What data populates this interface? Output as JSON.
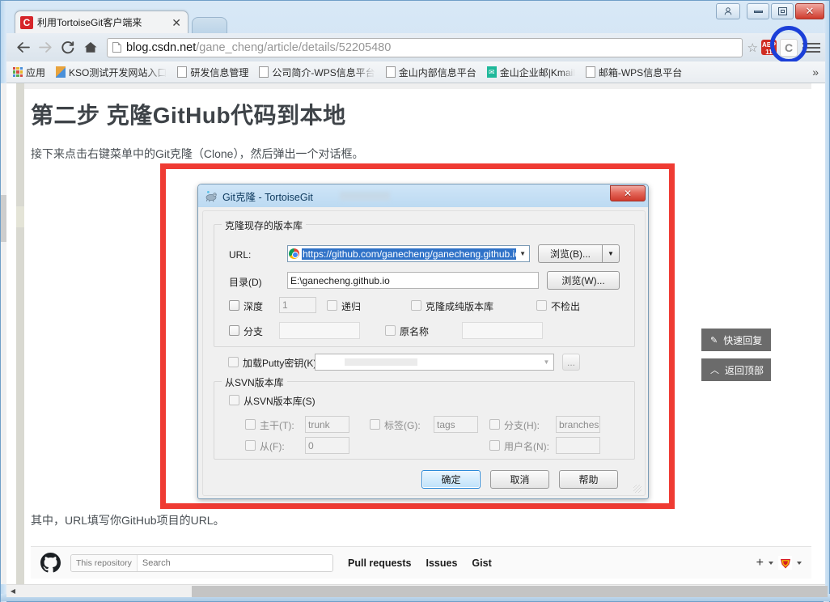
{
  "window": {
    "buttons": {
      "user": "user-account",
      "minimize": "Minimize",
      "maximize": "Maximize",
      "close": "✕"
    }
  },
  "browser": {
    "tab": {
      "title": "利用TortoiseGit客户端来",
      "close": "✕",
      "favicon_letter": "C"
    },
    "nav": {
      "back": "←",
      "forward": "→",
      "reload": "C",
      "home": "⌂"
    },
    "omnibox": {
      "url_host": "blog.csdn.net",
      "url_path": "/gane_cheng/article/details/52205480",
      "star": "☆"
    },
    "extensions": {
      "adblock_label": "ABP",
      "adblock_count": "11",
      "csdn_label": "C"
    },
    "menu": "chrome-menu",
    "bookmarks": [
      {
        "label": "应用",
        "icon": "apps-grid-icon"
      },
      {
        "label": "KSO测试开发网站入口",
        "icon": "wps-icon",
        "fade": true
      },
      {
        "label": "研发信息管理",
        "icon": "doc-icon"
      },
      {
        "label": "公司简介-WPS信息平台",
        "icon": "doc-icon",
        "fade": true
      },
      {
        "label": "金山内部信息平台",
        "icon": "doc-icon"
      },
      {
        "label": "金山企业邮|Kmail",
        "icon": "mail-icon",
        "fade": true
      },
      {
        "label": "邮箱-WPS信息平台",
        "icon": "doc-icon"
      }
    ],
    "bookmarks_overflow": "»"
  },
  "article": {
    "heading": "第二步 克隆GitHub代码到本地",
    "paragraph_above": "接下来点击右键菜单中的Git克隆（Clone），然后弹出一个对话框。",
    "paragraph_below": "其中，URL填写你GitHub项目的URL。"
  },
  "side_buttons": [
    {
      "icon": "✎",
      "label": "快速回复",
      "name": "quick-reply-button"
    },
    {
      "icon": "︿",
      "label": "返回顶部",
      "name": "back-to-top-button"
    }
  ],
  "dialog": {
    "title": "Git克隆 - TortoiseGit",
    "close": "✕",
    "group_clone": {
      "title": "克隆现存的版本库",
      "url_label": "URL:",
      "url_value": "https://github.com/ganecheng/ganecheng.github.io.git",
      "url_browse": "浏览(B)...",
      "dir_label": "目录(D)",
      "dir_value": "E:\\ganecheng.github.io",
      "dir_browse": "浏览(W)...",
      "options_row1": [
        {
          "label": "深度",
          "checked": false,
          "value": "1",
          "has_field": true
        },
        {
          "label": "递归",
          "checked": false
        },
        {
          "label": "克隆成纯版本库",
          "checked": false
        },
        {
          "label": "不检出",
          "checked": false
        }
      ],
      "options_row2": [
        {
          "label": "分支",
          "checked": false,
          "value": "",
          "has_field": true
        },
        {
          "label": "原名称",
          "checked": false,
          "value": "",
          "has_field": true
        }
      ],
      "putty_label": "加载Putty密钥(K)",
      "putty_value": "",
      "putty_browse": "..."
    },
    "group_svn": {
      "title": "从SVN版本库",
      "enable_label": "从SVN版本库(S)",
      "fields": [
        {
          "label": "主干(T):",
          "value": "trunk"
        },
        {
          "label": "标签(G):",
          "value": "tags"
        },
        {
          "label": "分支(H):",
          "value": "branches"
        },
        {
          "label": "从(F):",
          "value": "0"
        },
        {
          "label": "用户名(N):",
          "value": ""
        }
      ]
    },
    "buttons": {
      "ok": "确定",
      "cancel": "取消",
      "help": "帮助"
    }
  },
  "github_bar": {
    "scope": "This repository",
    "search_placeholder": "Search",
    "links": [
      "Pull requests",
      "Issues",
      "Gist"
    ],
    "plus": "+",
    "caret": "▾"
  }
}
